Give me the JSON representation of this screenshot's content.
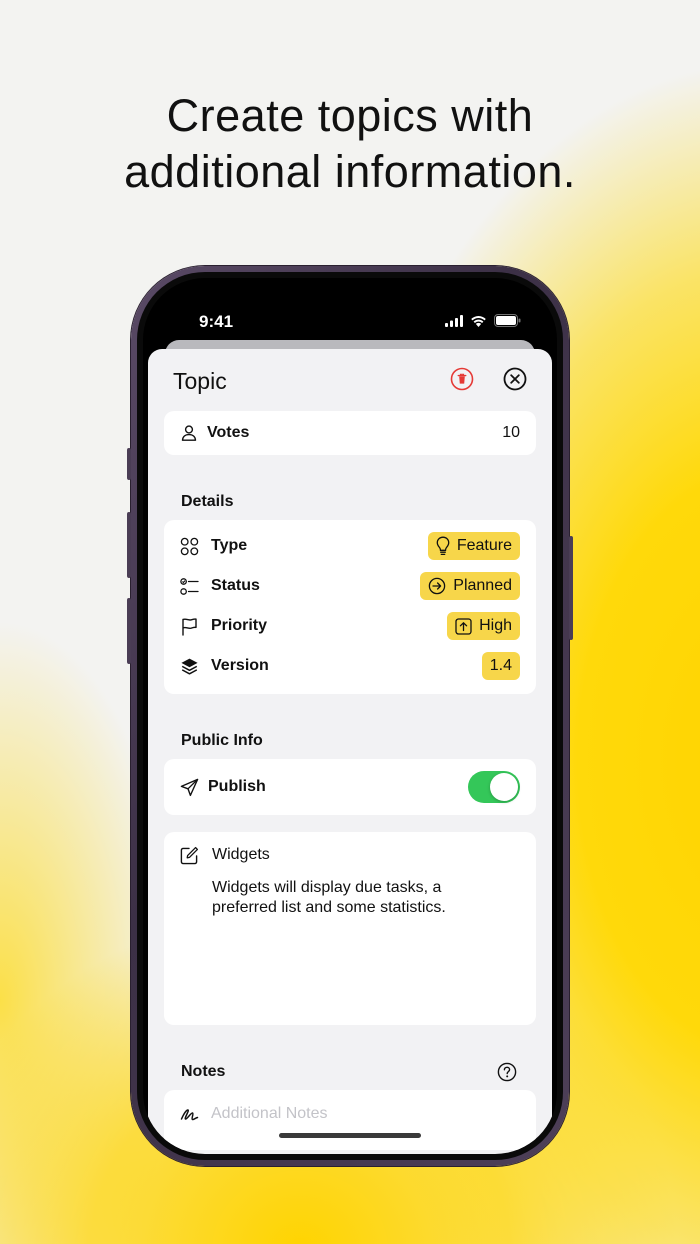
{
  "headline": {
    "line1": "Create topics with",
    "line2": "additional information."
  },
  "status_bar": {
    "time": "9:41",
    "icons": [
      "cellular-signal-icon",
      "wifi-icon",
      "battery-icon"
    ]
  },
  "sheet": {
    "title": "Topic",
    "delete_icon": "trash-icon",
    "close_icon": "close-circle-icon",
    "accent_delete": "#e53935"
  },
  "votes": {
    "icon": "person-icon",
    "label": "Votes",
    "value": "10"
  },
  "details": {
    "heading": "Details",
    "rows": [
      {
        "icon": "grid-circles-icon",
        "label": "Type",
        "value": "Feature",
        "value_icon": "lightbulb-icon"
      },
      {
        "icon": "checklist-icon",
        "label": "Status",
        "value": "Planned",
        "value_icon": "arrow-right-circle-icon"
      },
      {
        "icon": "flag-icon",
        "label": "Priority",
        "value": "High",
        "value_icon": "arrow-up-square-icon"
      },
      {
        "icon": "layers-icon",
        "label": "Version",
        "value": "1.4",
        "value_icon": ""
      }
    ],
    "pill_color": "#f7d64a"
  },
  "public_info": {
    "heading": "Public Info",
    "publish_label": "Publish",
    "publish_icon": "paper-plane-icon",
    "publish_on": true,
    "toggle_color": "#34c759"
  },
  "widgets": {
    "icon": "edit-square-icon",
    "title": "Widgets",
    "body": "Widgets will display due tasks, a preferred list and some statistics."
  },
  "notes": {
    "heading": "Notes",
    "help_icon": "question-circle-icon",
    "input_icon": "scribble-icon",
    "placeholder": "Additional Notes"
  }
}
